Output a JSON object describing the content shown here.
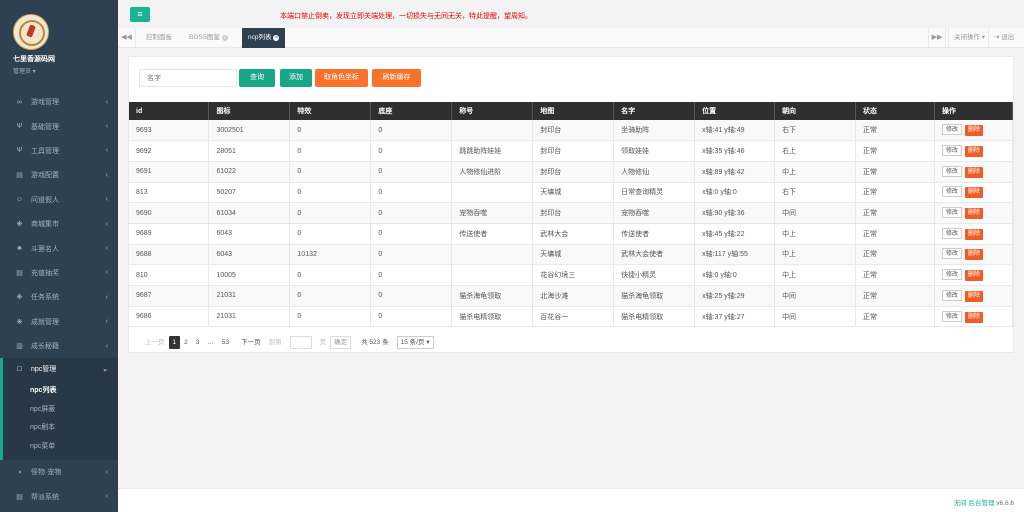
{
  "sidebar": {
    "site_name": "七里香源码网",
    "role": "管理员",
    "menu": [
      {
        "label": "游戏管理",
        "icon": "∞"
      },
      {
        "label": "基础管理",
        "icon": "Ψ"
      },
      {
        "label": "工具管理",
        "icon": "Ψ"
      },
      {
        "label": "游戏配置",
        "icon": "▤"
      },
      {
        "label": "问道假人",
        "icon": "☺"
      },
      {
        "label": "商城集市",
        "icon": "❋"
      },
      {
        "label": "斗罢名人",
        "icon": "♣"
      },
      {
        "label": "充值抽奖",
        "icon": "▤"
      },
      {
        "label": "任务系统",
        "icon": "❋"
      },
      {
        "label": "成就管理",
        "icon": "❋"
      },
      {
        "label": "成长秘籍",
        "icon": "▥"
      },
      {
        "label": "npc管理",
        "icon": "□"
      },
      {
        "label": "怪物·宠物",
        "icon": "◑"
      },
      {
        "label": "帮派系统",
        "icon": "▤"
      }
    ],
    "submenu": [
      "npc列表",
      "npc屏蔽",
      "npc剧本",
      "npc菜单"
    ]
  },
  "topbar": {
    "toggle_icon": "≡",
    "notice": "本端口禁止倒卖，发现立即关端处理，一切损失与无间无关，特此提醒，望周知。"
  },
  "tabs": {
    "prev": "◀◀",
    "next": "▶▶",
    "items": [
      "控制面板",
      "BOSS图鉴",
      "ncp列表"
    ],
    "close_ops": "关闭操作",
    "logout": "退出"
  },
  "toolbar": {
    "search_placeholder": "名字",
    "query": "查询",
    "add": "添加",
    "get_coord": "取角色坐标",
    "refresh_cache": "刷新缓存"
  },
  "table": {
    "headers": [
      "id",
      "图标",
      "特效",
      "底座",
      "称号",
      "地图",
      "名字",
      "位置",
      "朝向",
      "状态",
      "操作"
    ],
    "rows": [
      [
        "9693",
        "3002501",
        "0",
        "0",
        "",
        "封印台",
        "坐骑助阵",
        "x轴:41 y轴:49",
        "右下",
        "正常"
      ],
      [
        "9692",
        "28051",
        "0",
        "0",
        "跳跳助阵娃娃",
        "封印台",
        "领取娃娃",
        "x轴:35 y轴:46",
        "右上",
        "正常"
      ],
      [
        "9691",
        "61022",
        "0",
        "0",
        "人物修仙进阶",
        "封印台",
        "人物修仙",
        "x轴:89 y轴:42",
        "中上",
        "正常"
      ],
      [
        "813",
        "50207",
        "0",
        "0",
        "",
        "天墉城",
        "日常查询精灵",
        "x轴:0 y轴:0",
        "右下",
        "正常"
      ],
      [
        "9690",
        "61034",
        "0",
        "0",
        "宠物吞噬",
        "封印台",
        "宠物吞噬",
        "x轴:90 y轴:36",
        "中间",
        "正常"
      ],
      [
        "9689",
        "6043",
        "0",
        "0",
        "传送使者",
        "武林大会",
        "传送使者",
        "x轴:45 y轴:22",
        "中上",
        "正常"
      ],
      [
        "9688",
        "6043",
        "10132",
        "0",
        "",
        "天墉城",
        "武林大会使者",
        "x轴:117 y轴:55",
        "中上",
        "正常"
      ],
      [
        "810",
        "10005",
        "0",
        "0",
        "",
        "花谷幻境三",
        "快捷小精灵",
        "x轴:0 y轴:0",
        "中上",
        "正常"
      ],
      [
        "9687",
        "21031",
        "0",
        "0",
        "猫杀海龟领取",
        "北海沙滩",
        "猫杀海龟领取",
        "x轴:25 y轴:29",
        "中间",
        "正常"
      ],
      [
        "9686",
        "21031",
        "0",
        "0",
        "猫杀电精领取",
        "百花谷一",
        "猫杀电精领取",
        "x轴:37 y轴:27",
        "中间",
        "正常"
      ]
    ],
    "edit": "修改",
    "delete": "删除"
  },
  "pager": {
    "prev": "上一页",
    "pages": [
      "1",
      "2",
      "3",
      "…",
      "53"
    ],
    "next": "下一页",
    "goto": "到第",
    "page_unit": "页",
    "confirm": "确定",
    "total": "共 523 条",
    "per_page": "15 条/页"
  },
  "footer": {
    "brand": "无间 后台管理",
    "version": "v6.6.6"
  }
}
